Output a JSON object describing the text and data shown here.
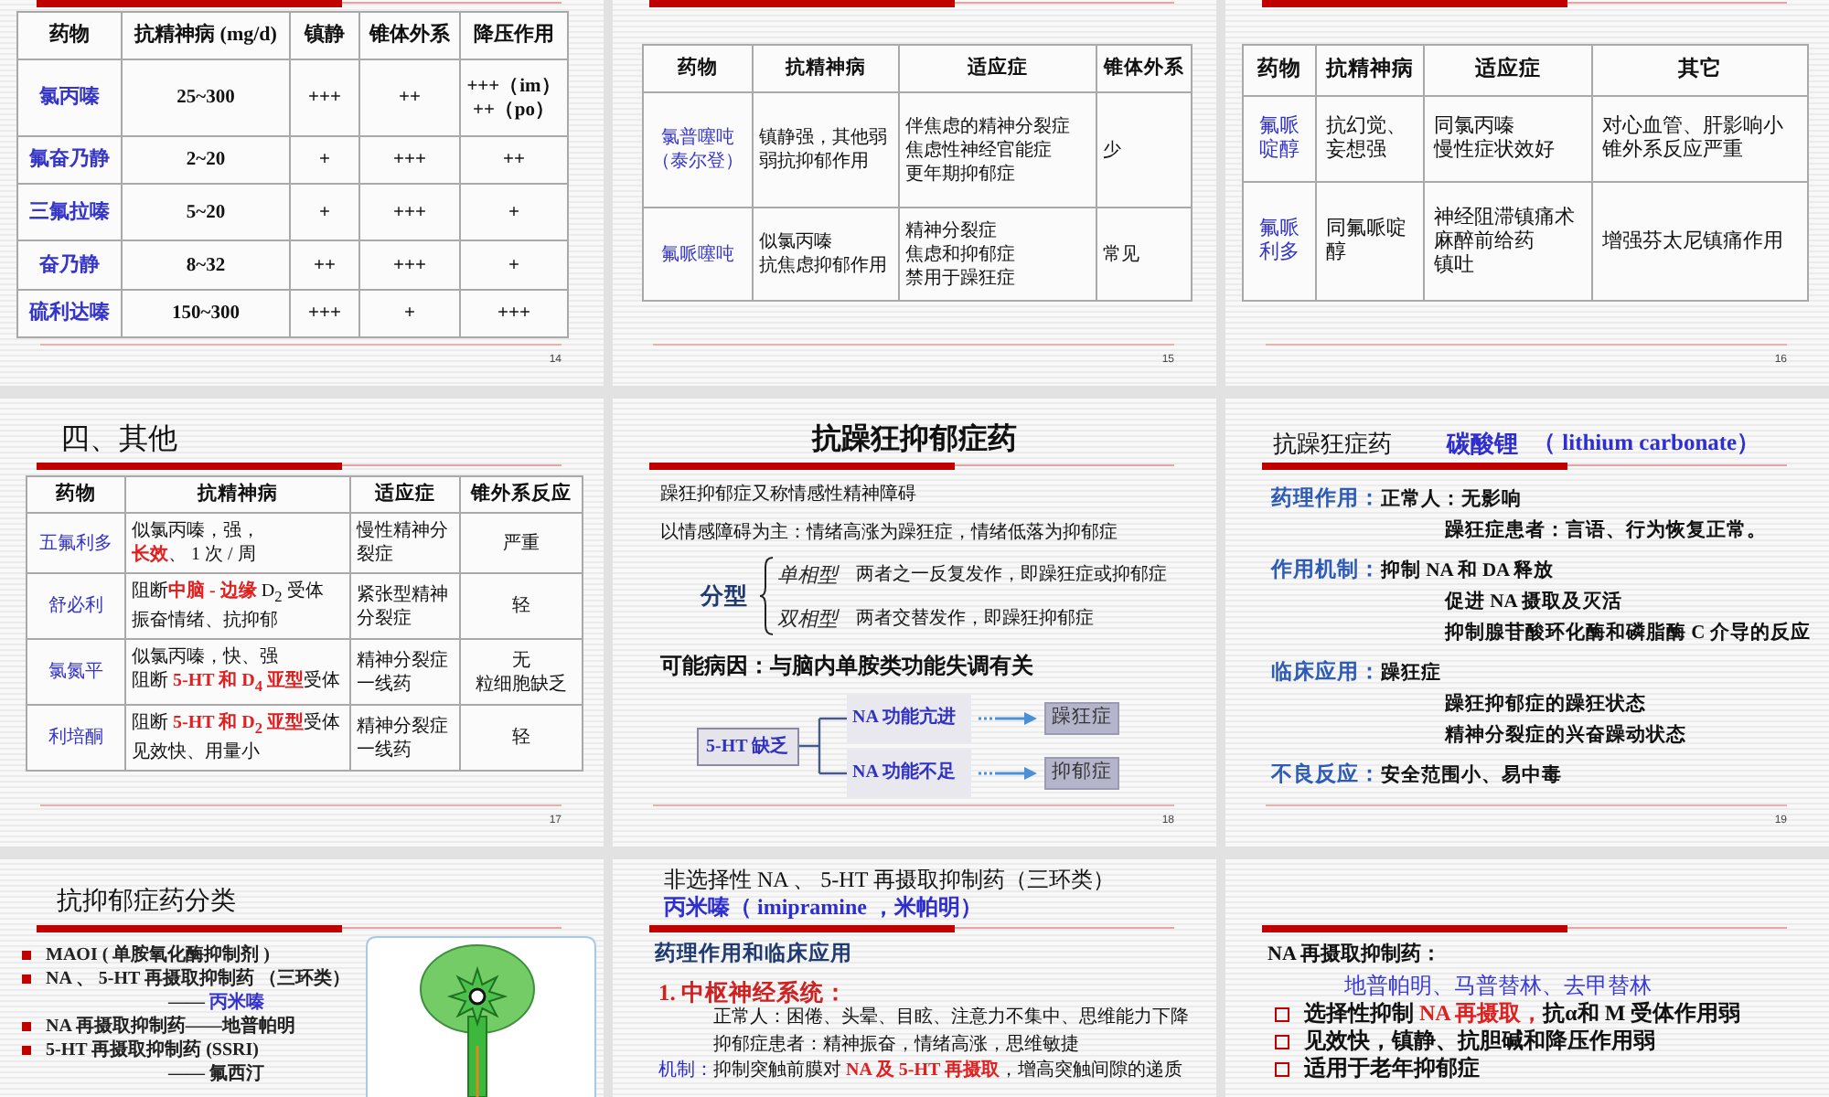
{
  "slides": [
    {
      "kind": "table",
      "page_number": "14",
      "table": {
        "columns": [
          "药物",
          "抗精神病 (mg/d)",
          "镇静",
          "锥体外系",
          "降压作用"
        ],
        "rows": [
          [
            "氯丙嗪",
            "25~300",
            "+++",
            "++",
            [
              "+++（im）",
              "++（po）"
            ]
          ],
          [
            "氟奋乃静",
            "2~20",
            "+",
            "+++",
            "++"
          ],
          [
            "三氟拉嗪",
            "5~20",
            "+",
            "+++",
            "+"
          ],
          [
            "奋乃静",
            "8~32",
            "++",
            "+++",
            "+"
          ],
          [
            "硫利达嗪",
            "150~300",
            "+++",
            "+",
            "+++"
          ]
        ]
      }
    },
    {
      "kind": "table",
      "page_number": "15",
      "table": {
        "columns": [
          "药物",
          "抗精神病",
          "适应症",
          "锥体外系"
        ],
        "rows": [
          [
            [
              "氯普噻吨",
              "（泰尔登）"
            ],
            [
              "镇静强，其他弱",
              "弱抗抑郁作用"
            ],
            [
              "伴焦虑的精神分裂症",
              "焦虑性神经官能症",
              "更年期抑郁症"
            ],
            "少"
          ],
          [
            "氟哌噻吨",
            [
              "似氯丙嗪",
              "抗焦虑抑郁作用"
            ],
            [
              "精神分裂症",
              "焦虑和抑郁症",
              "禁用于躁狂症"
            ],
            "常见"
          ]
        ]
      }
    },
    {
      "kind": "table",
      "page_number": "16",
      "table": {
        "columns": [
          "药物",
          "抗精神病",
          "适应症",
          "其它"
        ],
        "rows": [
          [
            "氟哌啶醇",
            "抗幻觉、妄想强",
            [
              "同氯丙嗪",
              "慢性症状效好"
            ],
            [
              "对心血管、肝影响小",
              "锥外系反应严重"
            ]
          ],
          [
            "氟哌利多",
            "同氟哌啶醇",
            [
              "神经阻滞镇痛术",
              "麻醉前给药",
              "镇吐"
            ],
            "增强芬太尼镇痛作用"
          ]
        ]
      }
    },
    {
      "kind": "table",
      "title": "四、其他",
      "page_number": "17",
      "table": {
        "columns": [
          "药物",
          "抗精神病",
          "适应症",
          "锥外系反应"
        ],
        "rows": [
          [
            "五氟利多",
            [
              "似氯丙嗪，强，",
              "**长效**、 1 次 / 周"
            ],
            "慢性精神分裂症",
            "严重"
          ],
          [
            "舒必利",
            [
              "阻断**中脑 - 边缘** D$_{2}$ 受体",
              "振奋情绪、抗抑郁"
            ],
            "紧张型精神分裂症",
            "轻"
          ],
          [
            "氯氮平",
            [
              "似氯丙嗪，快、强",
              "阻断 **5-HT 和 D$_{4}$ 亚型**受体"
            ],
            "精神分裂症一线药",
            {
              "lines": [
                "无"
              ],
              "note": "粒细胞缺乏"
            }
          ],
          [
            "利培酮",
            [
              "阻断 **5-HT 和 D$_{2}$ 亚型**受体",
              "见效快、用量小"
            ],
            "精神分裂症一线药",
            "轻"
          ]
        ]
      }
    },
    {
      "kind": "classification",
      "title": "抗躁狂抑郁症药",
      "page_number": "18",
      "paragraphs": [
        "躁狂抑郁症又称情感性精神障碍",
        "以情感障碍为主：情绪高涨为躁狂症，情绪低落为抑郁症"
      ],
      "split": {
        "label": "分型",
        "types": [
          {
            "name": "单相型",
            "description": "两者之一反复发作，即躁狂症或抑郁症"
          },
          {
            "name": "双相型",
            "description": "两者交替发作，即躁狂抑郁症"
          }
        ]
      },
      "cause": "可能病因：与脑内单胺类功能失调有关",
      "diagram": {
        "source": "5-HT 缺乏",
        "branches": [
          {
            "state": "NA 功能亢进",
            "result": "躁狂症"
          },
          {
            "state": "NA 功能不足",
            "result": "抑郁症"
          }
        ]
      }
    },
    {
      "kind": "sections",
      "title": "抗躁狂症药",
      "drug": "碳酸锂",
      "drug_en": "（ lithium carbonate）",
      "page_number": "19",
      "sections": [
        {
          "label": "药理作用：",
          "items": [
            "正常人：无影响",
            "躁狂症患者：言语、行为恢复正常。"
          ]
        },
        {
          "label": "作用机制：",
          "items": [
            "抑制 NA 和 DA 释放",
            "促进 NA 摄取及灭活",
            "抑制腺苷酸环化酶和磷脂酶 C 介导的反应"
          ]
        },
        {
          "label": "临床应用：",
          "items": [
            "躁狂症",
            "躁狂抑郁症的躁狂状态",
            "精神分裂症的兴奋躁动状态"
          ]
        },
        {
          "label": "不良反应：",
          "items": [
            "安全范围小、易中毒"
          ]
        }
      ]
    },
    {
      "kind": "outline",
      "title": "抗抑郁症药分类",
      "items": [
        {
          "kind": "bullet",
          "text": "MAOI ( 单胺氧化酶抑制剂 )"
        },
        {
          "kind": "bullet",
          "text": "NA 、 5-HT 再摄取抑制药 （三环类）"
        },
        {
          "kind": "example",
          "text": "—— **丙米嗪**"
        },
        {
          "kind": "bullet",
          "text": "NA 再摄取抑制药——地普帕明"
        },
        {
          "kind": "bullet",
          "text": "5-HT 再摄取抑制药 (SSRI)"
        },
        {
          "kind": "example",
          "text": "—— 氟西汀"
        }
      ]
    },
    {
      "kind": "notes",
      "title": "非选择性 NA 、 5-HT 再摄取抑制药（三环类）",
      "subtitle": "丙米嗪（ imipramine ，米帕明）",
      "heading": "药理作用和临床应用",
      "subheading": "1. 中枢神经系统：",
      "lines": [
        {
          "kind": "indent",
          "text": "正常人：困倦、头晕、目眩、注意力不集中、思维能力下降"
        },
        {
          "kind": "indent",
          "text": "抑郁症患者：精神振奋，情绪高涨，思维敏捷"
        },
        {
          "kind": "labeled",
          "label": "机制：",
          "text": "抑制突触前膜对 **NA 及 5-HT 再摄取**，增高突触间隙的递质"
        }
      ]
    },
    {
      "kind": "bullets",
      "heading": "NA 再摄取抑制药：",
      "examples": "地普帕明、马普替林、去甲替林",
      "items": [
        "选择性抑制 **NA 再摄取，**抗α和 M 受体作用弱",
        "见效快，镇静、抗胆碱和降压作用弱",
        "适用于老年抑郁症"
      ]
    }
  ]
}
